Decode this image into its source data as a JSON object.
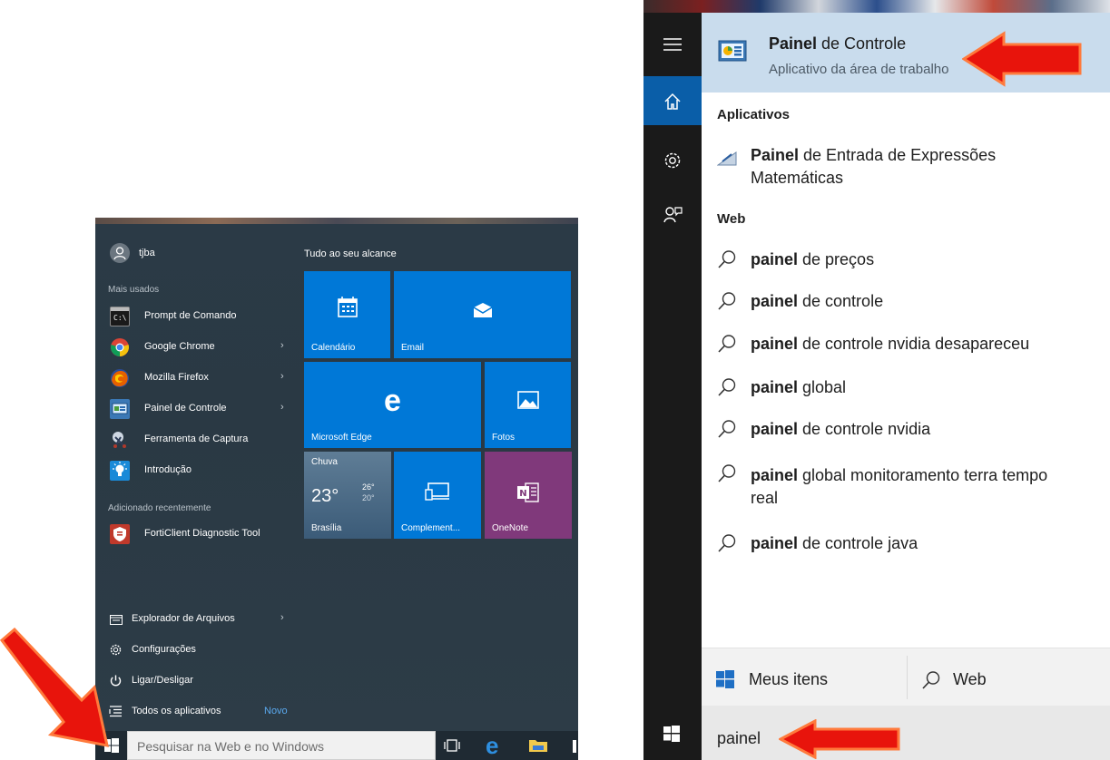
{
  "start_menu": {
    "user": "tjba",
    "most_used_header": "Mais usados",
    "apps": [
      {
        "label": "Prompt de Comando",
        "icon": "cmd-icon",
        "color": "#1f1f1f",
        "chevron": false
      },
      {
        "label": "Google Chrome",
        "icon": "chrome-icon",
        "color": "#e0a43a",
        "chevron": true
      },
      {
        "label": "Mozilla Firefox",
        "icon": "firefox-icon",
        "color": "#d86a2a",
        "chevron": true
      },
      {
        "label": "Painel de Controle",
        "icon": "control-panel-icon",
        "color": "#3b78b5",
        "chevron": true
      },
      {
        "label": "Ferramenta de Captura",
        "icon": "snipping-tool-icon",
        "color": "#5d6f8a",
        "chevron": false
      },
      {
        "label": "Introdução",
        "icon": "lightbulb-icon",
        "color": "#1a8ad8",
        "chevron": false
      }
    ],
    "recent_header": "Adicionado recentemente",
    "recent_app": {
      "label": "FortiClient Diagnostic Tool",
      "icon": "forticlient-icon",
      "color": "#c0392b"
    },
    "bottom_items": [
      {
        "label": "Explorador de Arquivos",
        "icon": "file-explorer-icon",
        "chevron": true
      },
      {
        "label": "Configurações",
        "icon": "gear-icon",
        "chevron": false
      },
      {
        "label": "Ligar/Desligar",
        "icon": "power-icon",
        "chevron": false
      }
    ],
    "all_apps": {
      "label": "Todos os aplicativos",
      "badge": "Novo"
    },
    "tiles_header": "Tudo ao seu alcance",
    "tiles": {
      "calendario": "Calendário",
      "email": "Email",
      "edge": "Microsoft Edge",
      "fotos": "Fotos",
      "weather": {
        "condition": "Chuva",
        "temp": "23°",
        "high": "26°",
        "low": "20°",
        "city": "Brasília"
      },
      "complement": "Complement...",
      "onenote": "OneNote"
    },
    "search_placeholder": "Pesquisar na Web e no Windows"
  },
  "search_panel": {
    "best_match": {
      "bold": "Painel",
      "rest": " de Controle",
      "subtitle": "Aplicativo da área de trabalho"
    },
    "apps_header": "Aplicativos",
    "app_result": {
      "bold": "Painel",
      "rest_line1": " de Entrada de Expressões",
      "line2": "Matemáticas"
    },
    "web_header": "Web",
    "web_results": [
      {
        "bold": "painel",
        "rest": " de preços"
      },
      {
        "bold": "painel",
        "rest": " de controle"
      },
      {
        "bold": "painel",
        "rest": " de controle nvidia desapareceu"
      },
      {
        "bold": "painel",
        "rest": " global"
      },
      {
        "bold": "painel",
        "rest": " de controle nvidia"
      },
      {
        "bold": "painel",
        "rest": " global monitoramento terra tempo"
      },
      {
        "bold": "painel",
        "rest": " de controle java"
      }
    ],
    "web_result_wrap": "real",
    "footer": {
      "my_items": "Meus itens",
      "web": "Web"
    },
    "query": "painel"
  },
  "colors": {
    "tile_blue": "#0078d7",
    "tile_purple": "#80397b",
    "arrow_red": "#e8140c",
    "rail_selected": "#0a5ea8"
  }
}
